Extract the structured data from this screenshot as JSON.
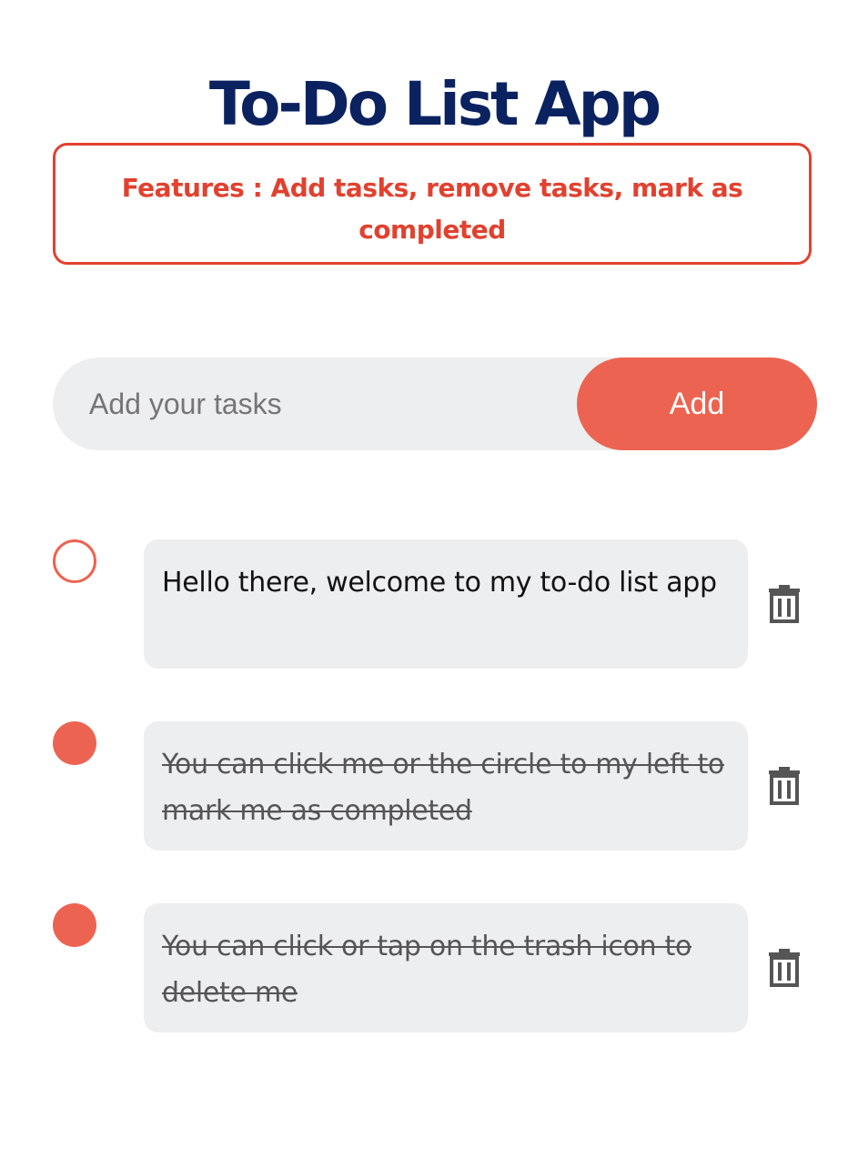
{
  "header": {
    "title": "To-Do List App"
  },
  "features_banner": {
    "text": "Features : Add tasks, remove tasks, mark as completed"
  },
  "add_task": {
    "placeholder": "Add your tasks",
    "value": "",
    "button_label": "Add"
  },
  "tasks": [
    {
      "text": "Hello there, welcome to my to-do list app",
      "completed": false
    },
    {
      "text": "You can click me or the circle to my left to mark me as completed",
      "completed": true
    },
    {
      "text": "You can click or tap on the trash icon to delete me",
      "completed": true
    }
  ],
  "icons": {
    "check": "circle-icon",
    "delete": "trash-icon"
  },
  "colors": {
    "title": "#0b2260",
    "accent": "#ec6451",
    "banner": "#e2412f",
    "surface": "#edeef0"
  }
}
